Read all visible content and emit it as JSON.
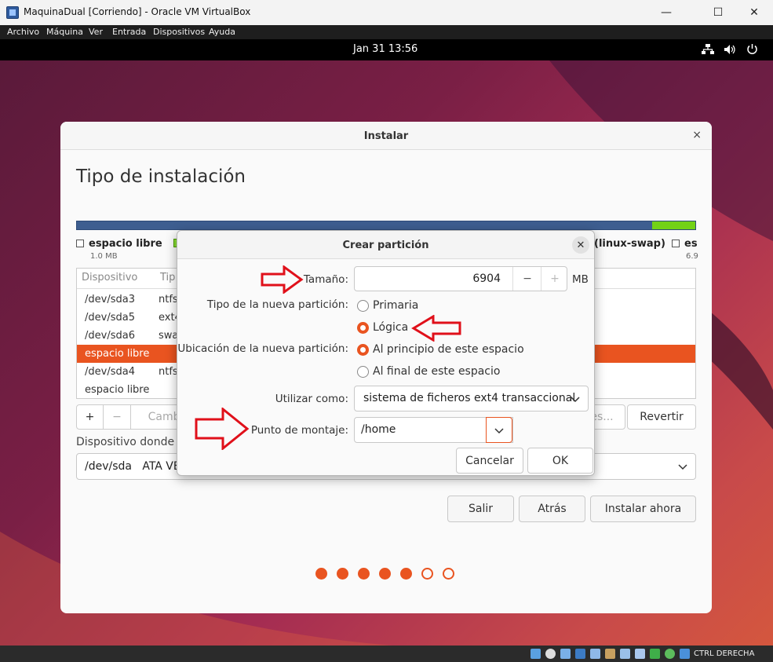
{
  "window": {
    "title": "MaquinaDual [Corriendo] - Oracle VM VirtualBox",
    "minimize_glyph": "—",
    "maximize_glyph": "☐",
    "close_glyph": "✕"
  },
  "menu": [
    "Archivo",
    "Máquina",
    "Ver",
    "Entrada",
    "Dispositivos",
    "Ayuda"
  ],
  "topbar": {
    "clock": "Jan 31  13:56"
  },
  "installer": {
    "title": "Instalar",
    "close_glyph": "×",
    "heading": "Tipo de instalación",
    "legend": [
      {
        "label": "espacio libre",
        "size": "1.0 MB"
      },
      {
        "label": "(linux-swap)",
        "size": ""
      },
      {
        "label": "es",
        "size": "6.9"
      }
    ],
    "table": {
      "headers": [
        "Dispositivo",
        "Tip"
      ],
      "rows": [
        {
          "device": "/dev/sda3",
          "type": "ntfs"
        },
        {
          "device": "/dev/sda5",
          "type": "ext4"
        },
        {
          "device": "/dev/sda6",
          "type": "swa"
        },
        {
          "device": "espacio libre",
          "type": ""
        },
        {
          "device": "/dev/sda4",
          "type": "ntfs"
        },
        {
          "device": "espacio libre",
          "type": ""
        }
      ],
      "selected_index": 3
    },
    "toolbar": {
      "add": "+",
      "remove": "−",
      "change": "Cambi",
      "new_table": "es...",
      "revert": "Revertir"
    },
    "boot_label": "Dispositivo donde i",
    "boot_device": "/dev/sda   ATA VB",
    "buttons": {
      "quit": "Salir",
      "back": "Atrás",
      "install": "Instalar ahora"
    },
    "progress": {
      "steps": 7,
      "completed": 5
    }
  },
  "dialog": {
    "title": "Crear partición",
    "close_glyph": "✕",
    "size_label": "Tamaño:",
    "size_value": "6904",
    "size_unit": "MB",
    "minus": "−",
    "plus": "+",
    "type_label": "Tipo de la nueva partición:",
    "type_options": [
      "Primaria",
      "Lógica"
    ],
    "type_selected": 1,
    "location_label": "Ubicación de la nueva partición:",
    "location_options": [
      "Al principio de este espacio",
      "Al final de este espacio"
    ],
    "location_selected": 0,
    "use_label": "Utilizar como:",
    "use_value": "sistema de ficheros ext4 transaccional",
    "mount_label": "Punto de montaje:",
    "mount_value": "/home",
    "cancel": "Cancelar",
    "ok": "OK"
  },
  "statusbar": {
    "host_key": "CTRL DERECHA"
  },
  "colors": {
    "accent": "#e95420",
    "annotation_arrow": "#e0101a"
  }
}
